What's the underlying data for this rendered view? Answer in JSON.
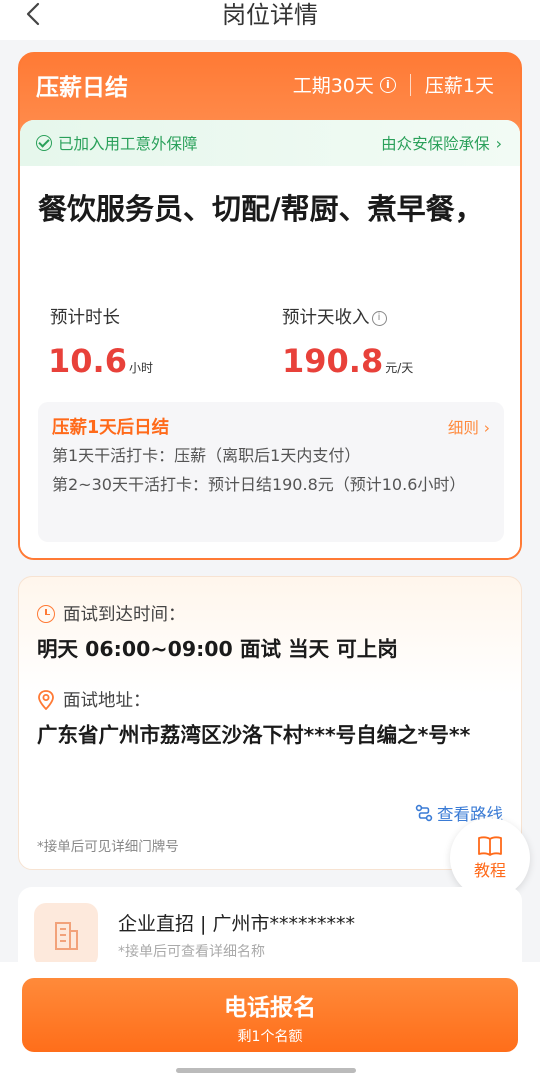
{
  "nav": {
    "title": "岗位详情"
  },
  "header": {
    "title": "压薪日结",
    "duration": "工期30天",
    "hold": "压薪1天"
  },
  "guarantee": {
    "left": "已加入用工意外保障",
    "right": "由众安保险承保"
  },
  "job": {
    "title": "餐饮服务员、切配/帮厨、煮早餐，"
  },
  "stats": {
    "hours_label": "预计时长",
    "hours_value": "10.6",
    "hours_unit": "小时",
    "income_label": "预计天收入",
    "income_value": "190.8",
    "income_unit": "元/天"
  },
  "rules": {
    "title": "压薪1天后日结",
    "more": "细则",
    "line1": "第1天干活打卡：压薪（离职后1天内支付）",
    "line2": "第2~30天干活打卡：预计日结190.8元（预计10.6小时）"
  },
  "interview": {
    "time_label": "面试到达时间：",
    "time_value": "明天 06:00~09:00 面试 当天 可上岗",
    "addr_label": "面试地址：",
    "addr_value": "广东省广州市荔湾区沙洛下村***号自编之*号**",
    "route": "查看路线",
    "note": "*接单后可见详细门牌号"
  },
  "tutorial": {
    "label": "教程"
  },
  "company": {
    "name": "企业直招 | 广州市*********",
    "note": "*接单后可查看详细名称"
  },
  "apply": {
    "main": "电话报名",
    "sub": "剩1个名额"
  }
}
